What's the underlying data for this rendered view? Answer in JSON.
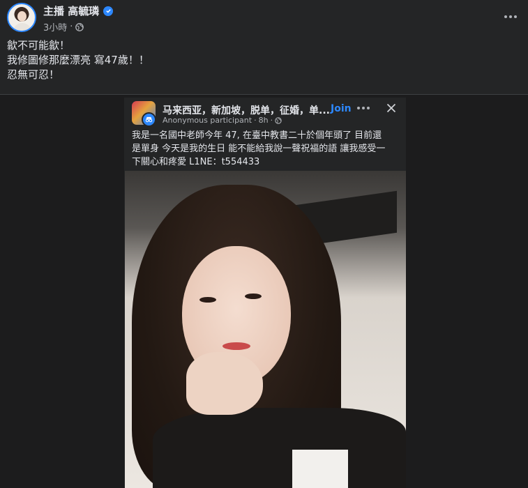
{
  "post": {
    "author_name": "主播 高毓璘",
    "timestamp": "3小時",
    "dot": "·",
    "visibility_icon": "globe-icon",
    "more_icon": "more-horizontal-icon",
    "lines": [
      "歙不可能歙！",
      "我修圖修那麼漂亮 寫47歲！！",
      "忍無可忍！"
    ]
  },
  "shared_screenshot": {
    "group_name": "马来西亚，新加坡，脱单，征婚，单...",
    "join_label": "Join",
    "poster": "Anonymous participant",
    "time": "8h",
    "dot": "·",
    "text_lines": [
      "我是一名國中老師今年 47, 在臺中教書二十於個年頭了 目前還",
      "是單身 今天是我的生日 能不能給我說一聲祝福的語 讓我感受一",
      "下關心和疼愛 L1NE：t554433"
    ]
  },
  "colors": {
    "background": "#242526",
    "accent": "#2d88ff",
    "text_primary": "#e4e6eb",
    "text_secondary": "#b0b3b8"
  }
}
